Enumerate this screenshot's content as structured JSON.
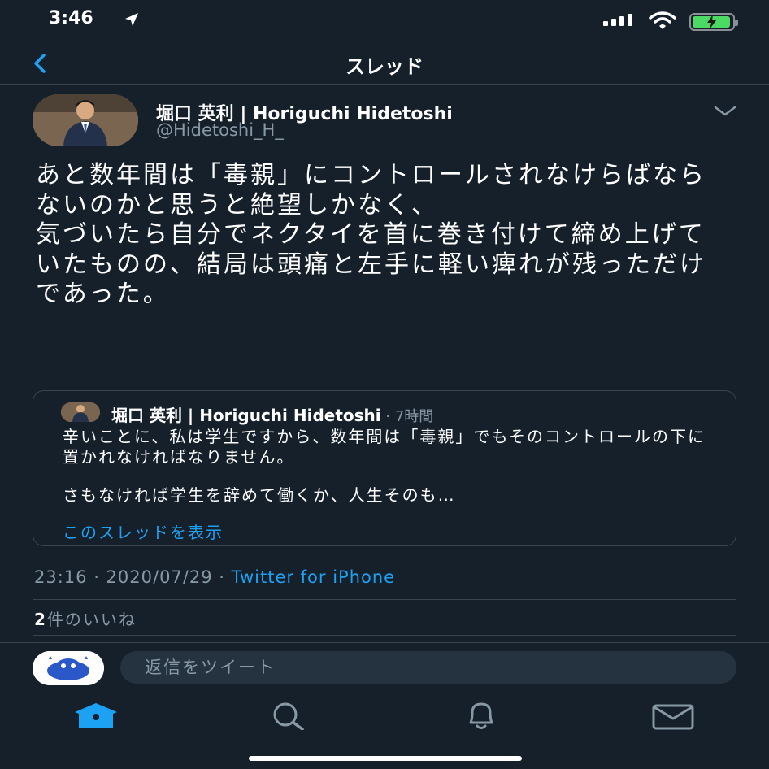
{
  "status_bar": {
    "time": "3:46"
  },
  "header": {
    "title": "スレッド"
  },
  "tweet": {
    "author_name": "堀口 英利 | Horiguchi Hidetoshi",
    "author_handle": "@Hidetoshi_H_",
    "text": "あと数年間は「毒親」にコントロールされなけらばならないのかと思うと絶望しかなく、\n気づいたら自分でネクタイを首に巻き付けて締め上げていたものの、結局は頭痛と左手に軽い痺れが残っただけであった。",
    "timestamp": "23:16 · 2020/07/29 · ",
    "source": "Twitter for iPhone",
    "likes_count": "2",
    "likes_label": "件のいいね"
  },
  "quote": {
    "author_name": "堀口 英利 | Horiguchi Hidetoshi",
    "separator": " · ",
    "time": "7時間",
    "paragraph1": "辛いことに、私は学生ですから、数年間は「毒親」でもそのコントロールの下に置かれなければなりません。",
    "paragraph2": "さもなければ学生を辞めて働くか、人生そのも…",
    "show_thread": "このスレッドを表示"
  },
  "reply": {
    "placeholder": "返信をツイート"
  },
  "tab_bar": {
    "tabs": [
      "home-icon",
      "search-icon",
      "bell-icon",
      "mail-icon"
    ]
  },
  "colors": {
    "background": "#15202b",
    "accent": "#1da1f2",
    "secondary_text": "#8899a6",
    "border": "#38444d"
  }
}
